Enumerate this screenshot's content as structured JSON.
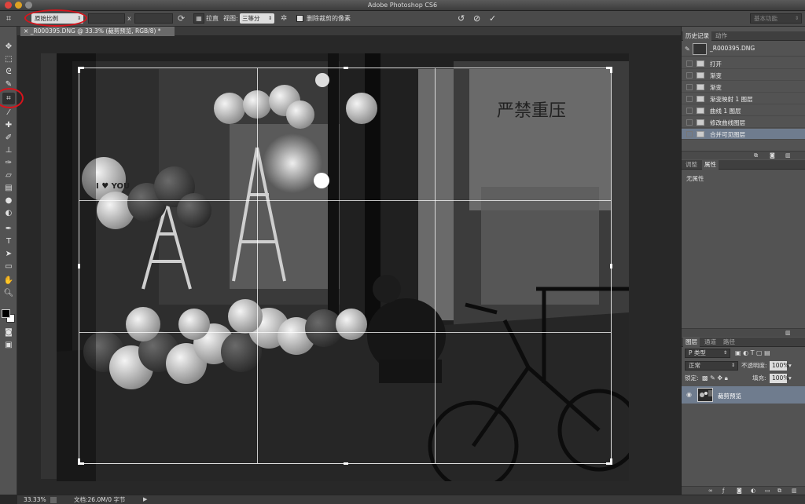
{
  "app": {
    "title": "Adobe Photoshop CS6"
  },
  "options_bar": {
    "ratio_select": "原始比例",
    "size_separator": "x",
    "straighten_label": "拉直",
    "view_label": "视图:",
    "view_select": "三等分",
    "delete_cropped_label": "删除裁剪的像素",
    "workspace_select": "基本功能"
  },
  "document": {
    "tab_label": "_R000395.DNG @ 33.3% (裁剪预览, RGB/8) *",
    "photo_text": "严禁重压",
    "balloon_text": "I ♥ YOU"
  },
  "status_bar": {
    "zoom": "33.33%",
    "doc_info": "文档:26.0M/0 字节"
  },
  "history_panel": {
    "tabs": [
      "历史记录",
      "动作"
    ],
    "snapshot": "_R000395.DNG",
    "items": [
      "打开",
      "渐变",
      "渐变",
      "渐变映射 1 图层",
      "曲线 1 图层",
      "修改曲线图层",
      "合并可见图层"
    ]
  },
  "properties_panel": {
    "tabs": [
      "调整",
      "属性"
    ],
    "text": "无属性"
  },
  "layers_panel": {
    "tabs": [
      "图层",
      "通道",
      "路径"
    ],
    "filter_select": "P 类型",
    "blend_mode": "正常",
    "opacity_label": "不透明度:",
    "opacity_value": "100%",
    "lock_label": "锁定:",
    "fill_label": "填充:",
    "fill_value": "100%",
    "layer_name": "裁剪预览"
  },
  "colors": {
    "annotation_red": "#d8141c",
    "selection_blue": "#6f7c8e"
  }
}
